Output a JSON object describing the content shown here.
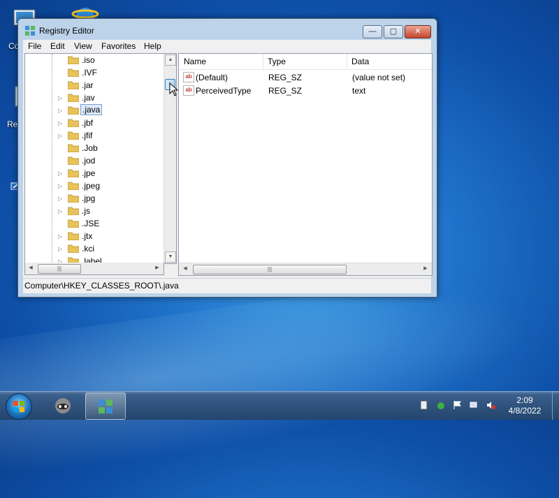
{
  "colors": {
    "accent": "#3399ff",
    "window_frame": "#bcd3ea",
    "taskbar": "#23456e"
  },
  "desktop": {
    "icon_labels": [
      "Co",
      "Rec"
    ]
  },
  "window": {
    "title": "Registry Editor",
    "controls": {
      "minimize": "—",
      "maximize": "▢",
      "close": "✕"
    },
    "menu": [
      "File",
      "Edit",
      "View",
      "Favorites",
      "Help"
    ],
    "tree": {
      "items": [
        {
          "label": ".iso",
          "expandable": false
        },
        {
          "label": ".IVF",
          "expandable": false
        },
        {
          "label": ".jar",
          "expandable": false
        },
        {
          "label": ".jav",
          "expandable": true
        },
        {
          "label": ".java",
          "expandable": true,
          "selected": true
        },
        {
          "label": ".jbf",
          "expandable": true
        },
        {
          "label": ".jfif",
          "expandable": true
        },
        {
          "label": ".Job",
          "expandable": false
        },
        {
          "label": ".jod",
          "expandable": false
        },
        {
          "label": ".jpe",
          "expandable": true
        },
        {
          "label": ".jpeg",
          "expandable": true
        },
        {
          "label": ".jpg",
          "expandable": true
        },
        {
          "label": ".js",
          "expandable": true
        },
        {
          "label": ".JSE",
          "expandable": false
        },
        {
          "label": ".jtx",
          "expandable": true
        },
        {
          "label": ".kci",
          "expandable": true
        },
        {
          "label": ".label",
          "expandable": true
        }
      ]
    },
    "list": {
      "columns": [
        "Name",
        "Type",
        "Data"
      ],
      "rows": [
        {
          "name": "(Default)",
          "type": "REG_SZ",
          "data": "(value not set)"
        },
        {
          "name": "PerceivedType",
          "type": "REG_SZ",
          "data": "text"
        }
      ]
    },
    "status": "Computer\\HKEY_CLASSES_ROOT\\.java"
  },
  "taskbar": {
    "items": [
      "start-orb",
      "pinned-app",
      "registry-editor"
    ],
    "clock": {
      "time": "2:09",
      "date": "4/8/2022"
    }
  }
}
